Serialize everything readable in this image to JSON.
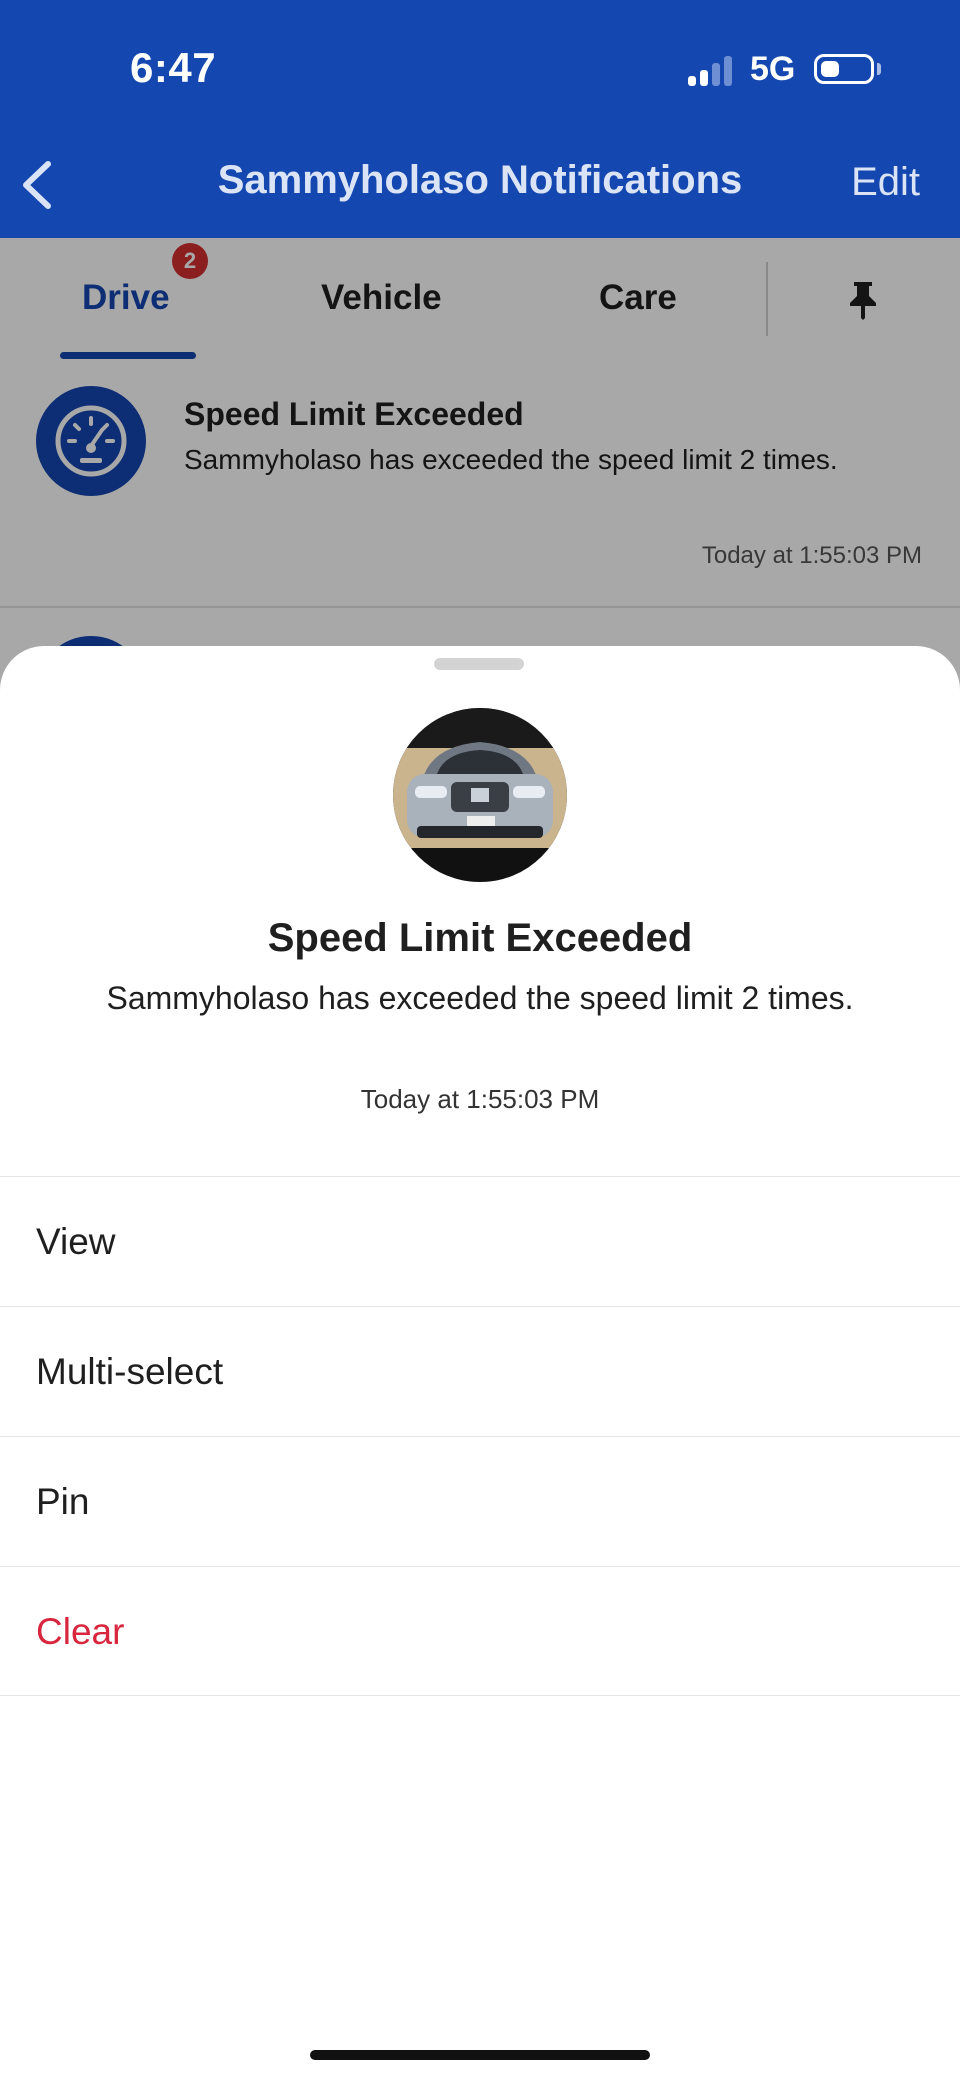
{
  "status_bar": {
    "time": "6:47",
    "network": "5G"
  },
  "nav": {
    "title": "Sammyholaso Notifications",
    "edit_label": "Edit"
  },
  "tabs": [
    {
      "label": "Drive",
      "badge": "2",
      "active": true
    },
    {
      "label": "Vehicle"
    },
    {
      "label": "Care"
    }
  ],
  "list_item": {
    "title": "Speed Limit Exceeded",
    "text": "Sammyholaso has exceeded the speed limit 2 times.",
    "time": "Today at 1:55:03 PM"
  },
  "sheet": {
    "title": "Speed Limit Exceeded",
    "text": "Sammyholaso has exceeded the speed limit 2 times.",
    "time": "Today at 1:55:03 PM",
    "actions": [
      {
        "label": "View"
      },
      {
        "label": "Multi-select"
      },
      {
        "label": "Pin"
      },
      {
        "label": "Clear",
        "style": "destructive"
      }
    ]
  },
  "colors": {
    "brand": "#1447b0",
    "badge": "#d32f2f",
    "destructive": "#d7263d"
  },
  "icons": [
    "back-chevron-icon",
    "pin-icon",
    "speedometer-icon",
    "signal-icon",
    "battery-icon"
  ]
}
